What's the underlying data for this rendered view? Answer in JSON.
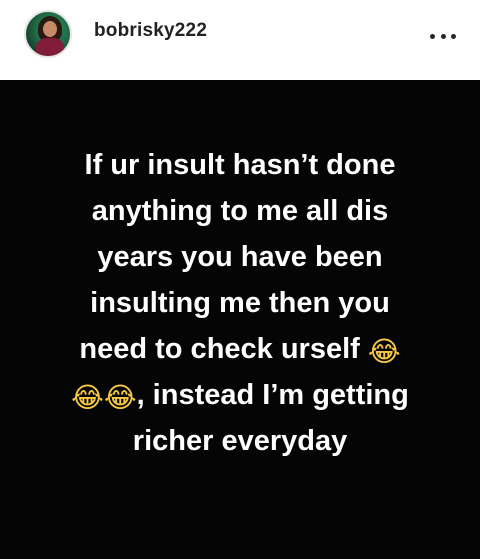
{
  "post_header": {
    "username": "bobrisky222",
    "avatar_icon": "profile-photo",
    "more_icon": "more-horizontal-icon"
  },
  "post_image": {
    "background_color": "#050505",
    "text_color": "#ffffff",
    "lines": [
      "If ur insult hasn’t done",
      "anything to me all dis",
      "years you have been",
      "insulting me then you",
      "need to check urself 😂",
      "😂😂, instead I’m getting",
      "richer everyday"
    ]
  }
}
